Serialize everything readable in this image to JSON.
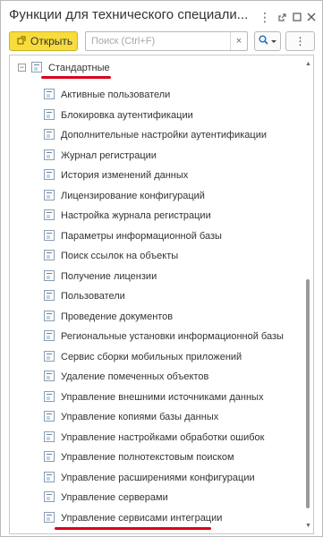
{
  "window": {
    "title": "Функции для технического специали...",
    "icons": [
      "more-icon",
      "link-icon",
      "maximize-icon",
      "close-icon"
    ]
  },
  "toolbar": {
    "open_label": "Открыть",
    "search_placeholder": "Поиск (Ctrl+F)",
    "clear_symbol": "×",
    "more_symbol": "⋮"
  },
  "tree": {
    "root_label": "Стандартные",
    "items": [
      "Активные пользователи",
      "Блокировка аутентификации",
      "Дополнительные настройки аутентификации",
      "Журнал регистрации",
      "История изменений данных",
      "Лицензирование конфигураций",
      "Настройка журнала регистрации",
      "Параметры информационной базы",
      "Поиск ссылок на объекты",
      "Получение лицензии",
      "Пользователи",
      "Проведение документов",
      "Региональные установки информационной базы",
      "Сервис сборки мобильных приложений",
      "Удаление помеченных объектов",
      "Управление внешними источниками данных",
      "Управление копиями базы данных",
      "Управление настройками обработки ошибок",
      "Управление полнотекстовым поиском",
      "Управление расширениями конфигурации",
      "Управление серверами",
      "Управление сервисами интеграции"
    ],
    "highlighted": [
      "Стандартные",
      "Управление сервисами интеграции"
    ]
  },
  "colors": {
    "accent_button": "#f7dc3b",
    "highlight_underline": "#d8001c",
    "border": "#b9b9b9"
  }
}
